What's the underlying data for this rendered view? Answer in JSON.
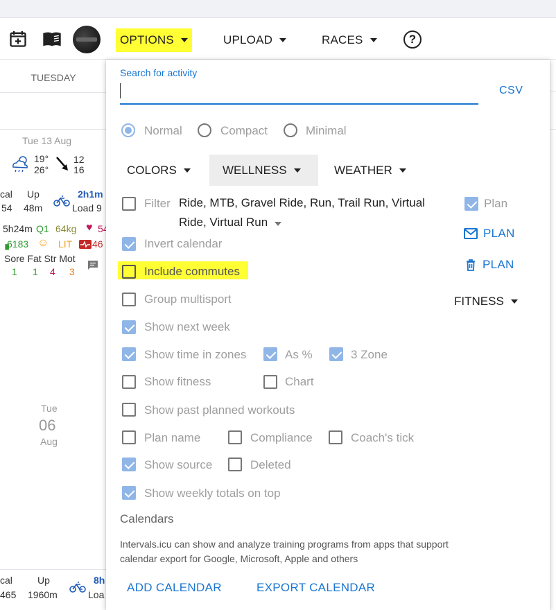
{
  "toolbar": {
    "options_label": "OPTIONS",
    "upload_label": "UPLOAD",
    "races_label": "RACES",
    "help_label": "?"
  },
  "calendar": {
    "day_header": "TUESDAY",
    "week1": {
      "date": "Tue 13 Aug",
      "temp_high": "19°",
      "temp_low": "26°",
      "wind_a": "12",
      "wind_b": "16",
      "kcal_label": "cal",
      "kcal_value": "54",
      "up_label": "Up",
      "up_value": "48m",
      "time": "2h1m",
      "load": "Load 9",
      "sleep": "5h24m",
      "q": "Q1",
      "weight": "64kg",
      "hr": "54",
      "steps": "6183",
      "lit": "LIT",
      "hrv": "46",
      "soreness_labels": "Sore Fat Str Mot",
      "s1": "1",
      "s2": "1",
      "s3": "4",
      "s4": "3"
    },
    "week2": {
      "day": "Tue",
      "num": "06",
      "month": "Aug",
      "kcal_label": "cal",
      "kcal_value": "465",
      "up_label": "Up",
      "up_value": "1960m",
      "time": "8h",
      "load": "Loa"
    }
  },
  "popup": {
    "search": {
      "label": "Search for activity",
      "value": ""
    },
    "csv_label": "CSV",
    "view_modes": [
      {
        "label": "Normal",
        "selected": true
      },
      {
        "label": "Compact",
        "selected": false
      },
      {
        "label": "Minimal",
        "selected": false
      }
    ],
    "tabs": {
      "colors": "COLORS",
      "wellness": "WELLNESS",
      "weather": "WEATHER"
    },
    "filter": {
      "label": "Filter",
      "checked": false,
      "value": "Ride, MTB, Gravel Ride, Run, Trail Run, Virtual Ride, Virtual Run"
    },
    "plan": {
      "label": "Plan",
      "checked": true
    },
    "plan_email": "PLAN",
    "plan_delete": "PLAN",
    "fitness_label": "FITNESS",
    "options": {
      "invert_calendar": {
        "label": "Invert calendar",
        "checked": true
      },
      "include_commutes": {
        "label": "Include commutes",
        "checked": false
      },
      "group_multisport": {
        "label": "Group multisport",
        "checked": false
      },
      "show_next_week": {
        "label": "Show next week",
        "checked": true
      },
      "show_time_in_zones": {
        "label": "Show time in zones",
        "checked": true
      },
      "as_percent": {
        "label": "As %",
        "checked": true
      },
      "three_zone": {
        "label": "3 Zone",
        "checked": true
      },
      "show_fitness": {
        "label": "Show fitness",
        "checked": false
      },
      "chart": {
        "label": "Chart",
        "checked": false
      },
      "show_past_planned": {
        "label": "Show past planned workouts",
        "checked": false
      },
      "plan_name": {
        "label": "Plan name",
        "checked": false
      },
      "compliance": {
        "label": "Compliance",
        "checked": false
      },
      "coach_tick": {
        "label": "Coach's tick",
        "checked": false
      },
      "show_source": {
        "label": "Show source",
        "checked": true
      },
      "deleted": {
        "label": "Deleted",
        "checked": false
      },
      "weekly_totals_top": {
        "label": "Show weekly totals on top",
        "checked": true
      }
    },
    "calendars": {
      "heading": "Calendars",
      "description": "Intervals.icu can show and analyze training programs from apps that support calendar export for Google, Microsoft, Apple and others",
      "add_label": "ADD CALENDAR",
      "export_label": "EXPORT CALENDAR"
    }
  },
  "colors": {
    "accent": "#1976d2",
    "checkbox_checked": "#90b6e8",
    "highlight": "#ffff33"
  }
}
